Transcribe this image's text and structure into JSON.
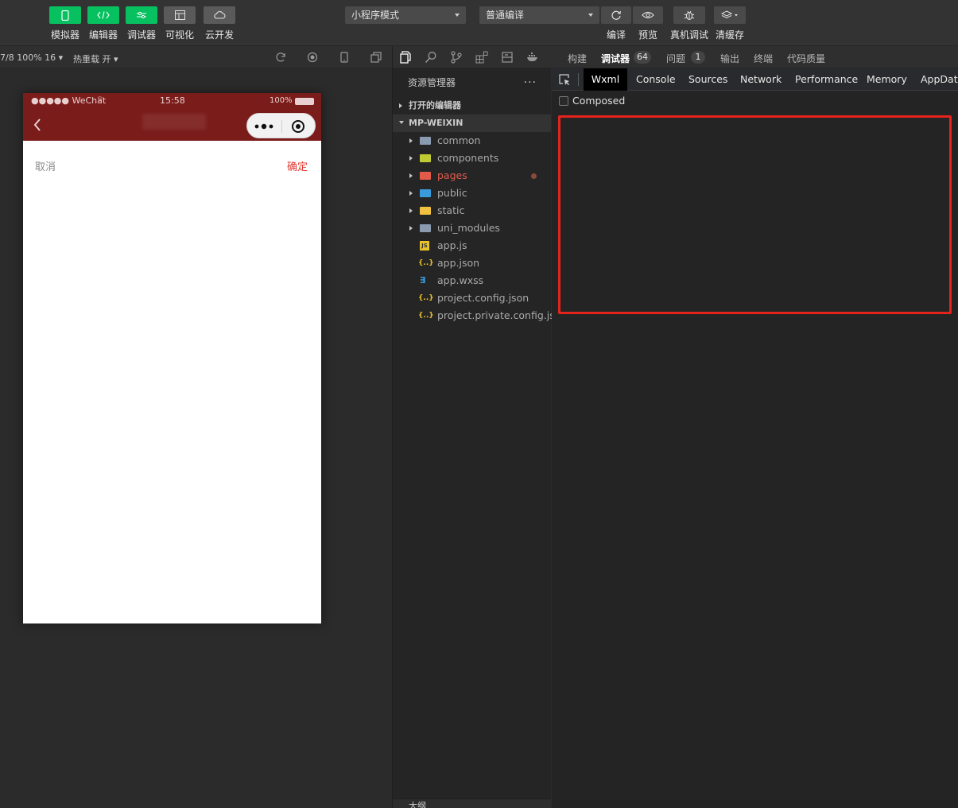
{
  "toolbar": {
    "left_tools": [
      {
        "label": "模拟器",
        "icon": "phone-icon",
        "active": true
      },
      {
        "label": "编辑器",
        "icon": "code-icon",
        "active": true
      },
      {
        "label": "调试器",
        "icon": "debug-icon",
        "active": true
      },
      {
        "label": "可视化",
        "icon": "layout-icon",
        "active": false
      },
      {
        "label": "云开发",
        "icon": "cloud-icon",
        "active": false
      }
    ],
    "mode_select": "小程序模式",
    "compile_select": "普通编译",
    "right_tools": [
      {
        "label": "编译",
        "icon": "refresh-icon"
      },
      {
        "label": "预览",
        "icon": "eye-icon"
      },
      {
        "label": "真机调试",
        "icon": "bug-icon"
      },
      {
        "label": "清缓存",
        "icon": "layers-icon"
      }
    ]
  },
  "simulator": {
    "device_label": "7/8 100% 16",
    "hot_reload": "热重载 开",
    "status": {
      "carrier": "●●●●● WeChat",
      "time": "15:58",
      "battery": "100%"
    },
    "page": {
      "cancel": "取消",
      "confirm": "确定"
    },
    "colors": {
      "navbar": "#7a1c1a",
      "confirm": "#e0362c"
    }
  },
  "explorer": {
    "title": "资源管理器",
    "more": "···",
    "open_editors": "打开的编辑器",
    "project": "MP-WEIXIN",
    "items": [
      {
        "name": "common",
        "type": "folder",
        "icon": "folder-icon",
        "color": "#8a9bb0"
      },
      {
        "name": "components",
        "type": "folder",
        "icon": "components-folder-icon",
        "color": "#c0ca33"
      },
      {
        "name": "pages",
        "type": "folder",
        "icon": "pages-folder-icon",
        "color": "#e25b4a",
        "highlight": "#e25b4a"
      },
      {
        "name": "public",
        "type": "folder",
        "icon": "public-folder-icon",
        "color": "#3a9bdc"
      },
      {
        "name": "static",
        "type": "folder",
        "icon": "static-folder-icon",
        "color": "#f0c040"
      },
      {
        "name": "uni_modules",
        "type": "folder",
        "icon": "folder-icon",
        "color": "#8a9bb0"
      },
      {
        "name": "app.js",
        "type": "file",
        "icon": "js-file-icon",
        "color": "#e8c32a"
      },
      {
        "name": "app.json",
        "type": "file",
        "icon": "json-file-icon",
        "color": "#e8c32a"
      },
      {
        "name": "app.wxss",
        "type": "file",
        "icon": "css-file-icon",
        "color": "#3a9bdc"
      },
      {
        "name": "project.config.json",
        "type": "file",
        "icon": "json-file-icon",
        "color": "#e8c32a"
      },
      {
        "name": "project.private.config.js...",
        "type": "file",
        "icon": "json-file-icon",
        "color": "#e8c32a"
      }
    ],
    "footer": "大纲"
  },
  "debugger": {
    "top_tabs": [
      "构建",
      "调试器",
      "问题",
      "输出",
      "终端",
      "代码质量"
    ],
    "debugger_count": "64",
    "problems_count": "1",
    "dev_tabs": [
      "Wxml",
      "Console",
      "Sources",
      "Network",
      "Performance",
      "Memory",
      "AppData"
    ],
    "composed_label": "Composed",
    "highlight_color": "#e5231c"
  }
}
